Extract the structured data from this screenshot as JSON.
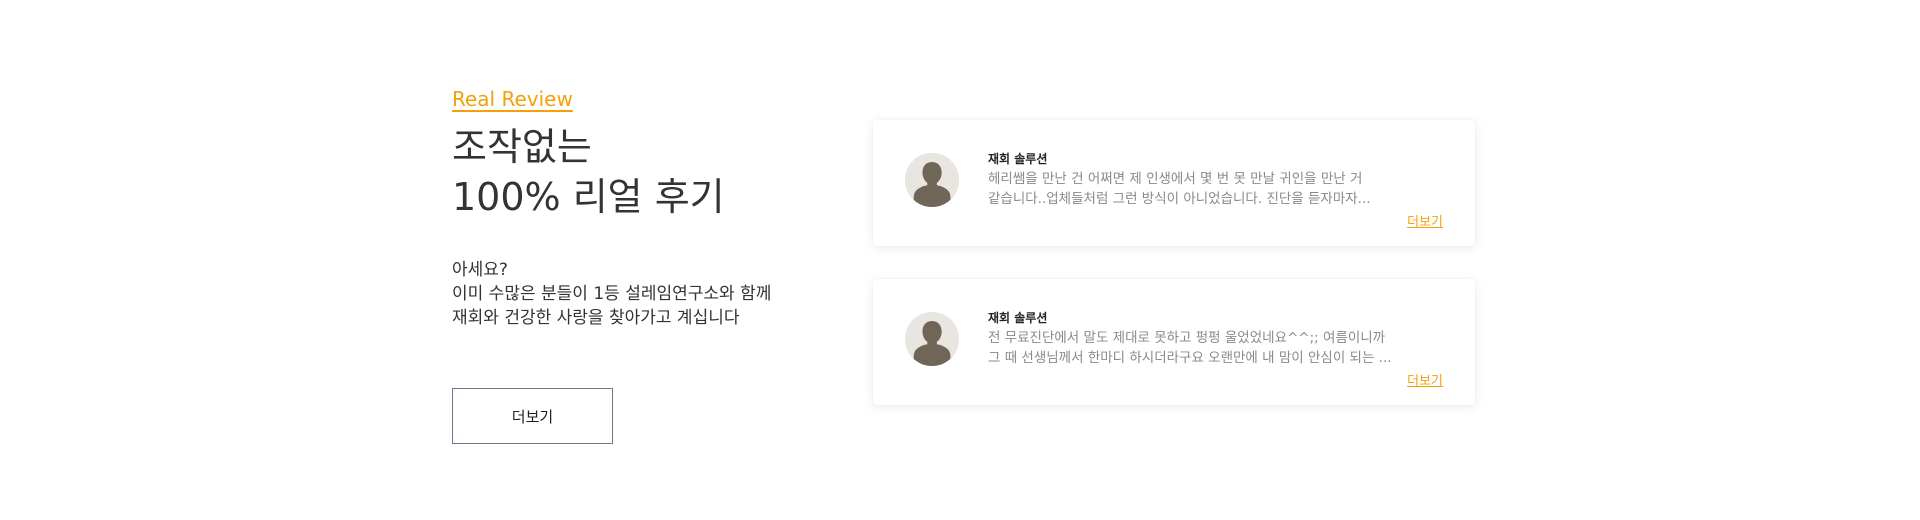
{
  "intro": {
    "eyebrow": "Real Review",
    "title_lines": [
      "조작없는",
      "100% 리얼 후기"
    ],
    "desc_lines": [
      "아세요?",
      "이미 수많은 분들이 1등 설레임연구소와 함께",
      "재회와 건강한 사랑을 찾아가고 계십니다"
    ],
    "more_button": "더보기"
  },
  "reviews": [
    {
      "category": "재회 솔루션",
      "lines": [
        "헤리쌤을 만난 건 어쩌면 제 인생에서 몇 번 못 만날 귀인을 만난 거",
        "같습니다..업체들처럼 그런 방식이 아니었습니다. 진단을 듣자마자..."
      ],
      "more_link": "더보기",
      "avatar_icon": "user-silhouette-icon"
    },
    {
      "category": "재회 솔루션",
      "lines": [
        "전 무료진단에서 말도 제대로 못하고 펑펑 울었었네요^^;; 여름이니까",
        "그 때 선생님께서 한마디 하시더라구요 오랜만에  내 맘이 안심이 되는 ..."
      ],
      "more_link": "더보기",
      "avatar_icon": "user-silhouette-icon"
    }
  ],
  "colors": {
    "accent": "#f5a00a",
    "text_dark": "#333333",
    "text_muted": "#8a8a8a",
    "button_border": "#6b7a8c",
    "avatar_bg": "#e9e6e1",
    "avatar_figure": "#6f6658"
  }
}
